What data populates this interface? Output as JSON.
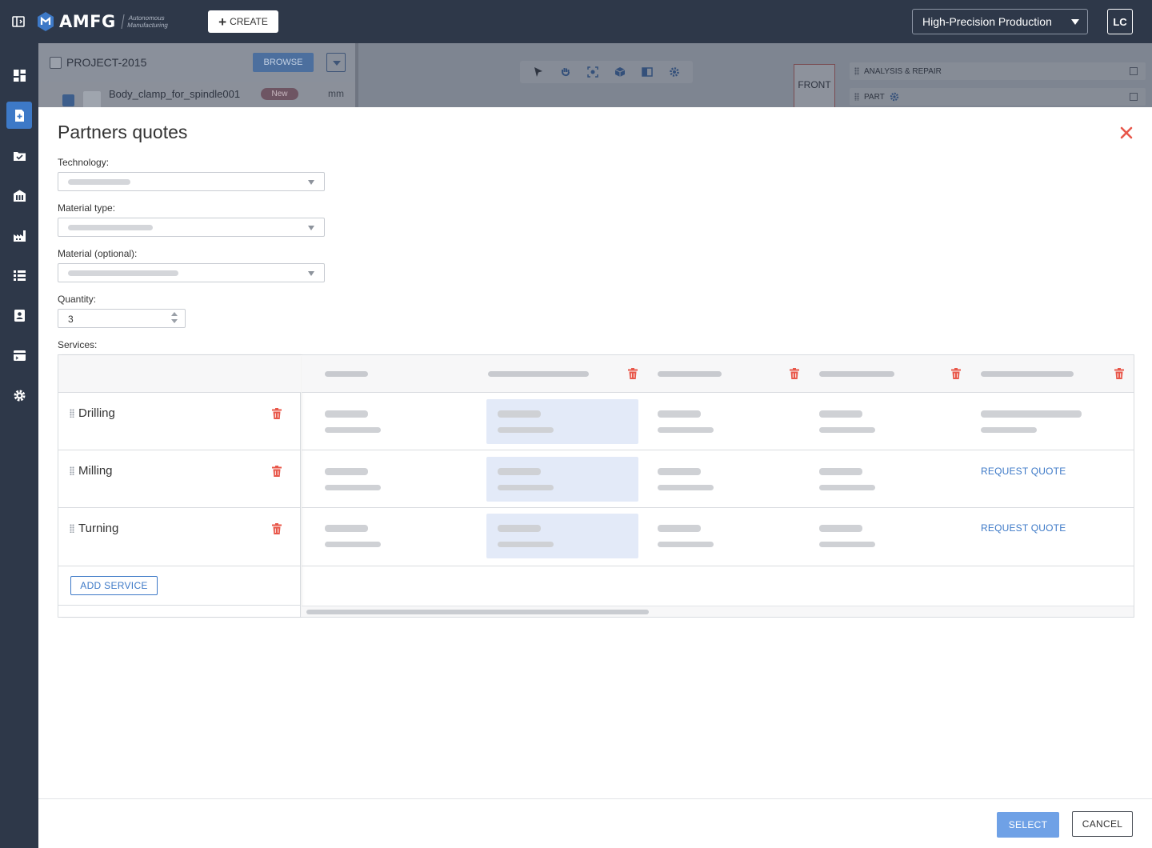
{
  "brand": {
    "name": "AMFG",
    "tagline_line1": "Autonomous",
    "tagline_line2": "Manufacturing"
  },
  "topbar": {
    "create_label": "CREATE",
    "workspace": "High-Precision Production",
    "user_initials": "LC"
  },
  "nav": {
    "items": [
      "dashboard-icon",
      "new-order-icon",
      "orders-icon",
      "factory-building-icon",
      "production-icon",
      "list-icon",
      "contacts-icon",
      "billing-icon",
      "settings-icon"
    ],
    "active_index": 1
  },
  "background": {
    "project_name": "PROJECT-2015",
    "browse_label": "BROWSE",
    "part_name": "Body_clamp_for_spindle001",
    "part_badge": "New",
    "part_unit": "mm",
    "view_label": "FRONT",
    "panel_analysis": "ANALYSIS & REPAIR",
    "panel_part": "PART"
  },
  "modal": {
    "title": "Partners quotes",
    "technology_label": "Technology:",
    "material_type_label": "Material type:",
    "material_label": "Material (optional):",
    "quantity_label": "Quantity:",
    "quantity_value": "3",
    "services_label": "Services:",
    "services": [
      {
        "name": "Drilling",
        "action": ""
      },
      {
        "name": "Milling",
        "action": "REQUEST QUOTE"
      },
      {
        "name": "Turning",
        "action": "REQUEST QUOTE"
      }
    ],
    "add_service_label": "ADD SERVICE",
    "select_label": "SELECT",
    "cancel_label": "CANCEL"
  },
  "colors": {
    "accent": "#3d79c7",
    "danger": "#e8574a",
    "topbar": "#2e3849",
    "highlight": "#e3eaf8"
  }
}
